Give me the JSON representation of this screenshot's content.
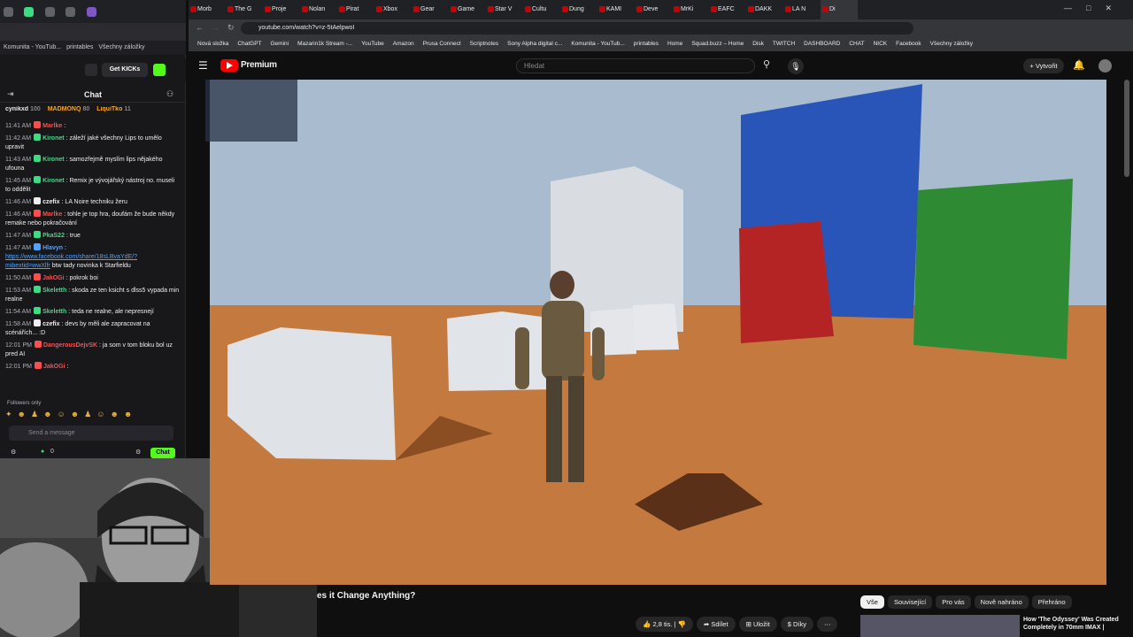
{
  "left_window": {
    "bookmarks": [
      "Komunita - YouTub...",
      "printables",
      "Všechny záložky"
    ],
    "get_kicks_label": "Get KICKs",
    "chat_title": "Chat",
    "top_gifters": [
      {
        "name": "cynikxd",
        "count": "100",
        "color": "#e8e8e8"
      },
      {
        "name": "MADMONQ",
        "count": "80",
        "color": "#f5a623"
      },
      {
        "name": "LiquiTko",
        "count": "11",
        "color": "#f5a623"
      }
    ],
    "messages": [
      {
        "time": "11:41 AM",
        "user": "Marlke",
        "color": "#ff4d4d",
        "text": ":"
      },
      {
        "time": "11:42 AM",
        "user": "Kironet",
        "color": "#3ddc84",
        "text": ": záleží jaké všechny Lips to umělo upravit"
      },
      {
        "time": "11:43 AM",
        "user": "Kironet",
        "color": "#3ddc84",
        "text": ": samozřejmě myslím lips nějakého ufouna"
      },
      {
        "time": "11:45 AM",
        "user": "Kironet",
        "color": "#3ddc84",
        "text": ": Remix je vývojářský nástroj no. museli to oddělit"
      },
      {
        "time": "11:46 AM",
        "user": "czefix",
        "color": "#efeff1",
        "text": ": LA Noire techniku žeru"
      },
      {
        "time": "11:46 AM",
        "user": "Marlke",
        "color": "#ff4d4d",
        "text": ": tohle je top hra, doufám že bude někdy remake nebo pokračování"
      },
      {
        "time": "11:47 AM",
        "user": "PkaS22",
        "color": "#3ddc84",
        "text": ": true"
      },
      {
        "time": "11:47 AM",
        "user": "Hlavyn",
        "color": "#4fa3ff",
        "text": ":",
        "link": "https://www.facebook.com/share/18sLBvaYdE/?mibextid=wwXlfr",
        "after": " btw tady novinka k Starfieldu"
      },
      {
        "time": "11:50 AM",
        "user": "JakOGi",
        "color": "#ff4d4d",
        "text": ": pokrok boi"
      },
      {
        "time": "11:53 AM",
        "user": "Skeletth",
        "color": "#3ddc84",
        "text": ": skoda ze ten ksicht s dlss5 vypada min realne"
      },
      {
        "time": "11:54 AM",
        "user": "Skeletth",
        "color": "#3ddc84",
        "text": ": teda ne realne, ale nepresnejí"
      },
      {
        "time": "11:58 AM",
        "user": "czefix",
        "color": "#efeff1",
        "text": ": devs by měli ale zapracovat na scénářích... :D"
      },
      {
        "time": "12:01 PM",
        "user": "DangerousDejvSK",
        "color": "#ff4d4d",
        "text": ": ja som v tom bloku bol uz pred AI"
      },
      {
        "time": "12:01 PM",
        "user": "JakOGi",
        "color": "#ff4d4d",
        "text": ":"
      }
    ],
    "followers_only": "Followers only",
    "input_placeholder": "Send a message",
    "viewer_count": "0",
    "chat_button": "Chat"
  },
  "browser": {
    "tabs": [
      "Morb",
      "The G",
      "Proje",
      "Nolan",
      "Pirat",
      "Xbox",
      "Gear",
      "Game",
      "Star V",
      "Cultu",
      "Dung",
      "KAMI",
      "Deve",
      "MrKi",
      "EAFC",
      "DAKK",
      "LA N",
      "Di"
    ],
    "url": "youtube.com/watch?v=z-5tAelpwoI",
    "bookmarks": [
      "Nová složka",
      "ChatGPT",
      "Gemini",
      "Mazarin1k Stream -...",
      "YouTube",
      "Amazon",
      "Prusa Connect",
      "Scriptnotes",
      "Sony Alpha digital c...",
      "Komunita - YouTub...",
      "printables",
      "Home",
      "Squad.buzz – Home",
      "Disk",
      "TWITCH",
      "DASHBOARD",
      "CHAT",
      "NICK",
      "Facebook",
      "Všechny záložky"
    ]
  },
  "youtube": {
    "premium_label": "Premium",
    "search_placeholder": "Hledat",
    "create_label": "Vytvořit",
    "video_title": "es it Change Anything?",
    "chips": [
      "Vše",
      "Související",
      "Pro vás",
      "Nově nahráno",
      "Přehráno"
    ],
    "like_count": "2,8 tis.",
    "share_label": "Sdílet",
    "save_label": "Uložit",
    "thanks_label": "Díky",
    "recommendation_title": "How 'The Odyssey' Was Created Completely in 70mm IMAX |"
  }
}
